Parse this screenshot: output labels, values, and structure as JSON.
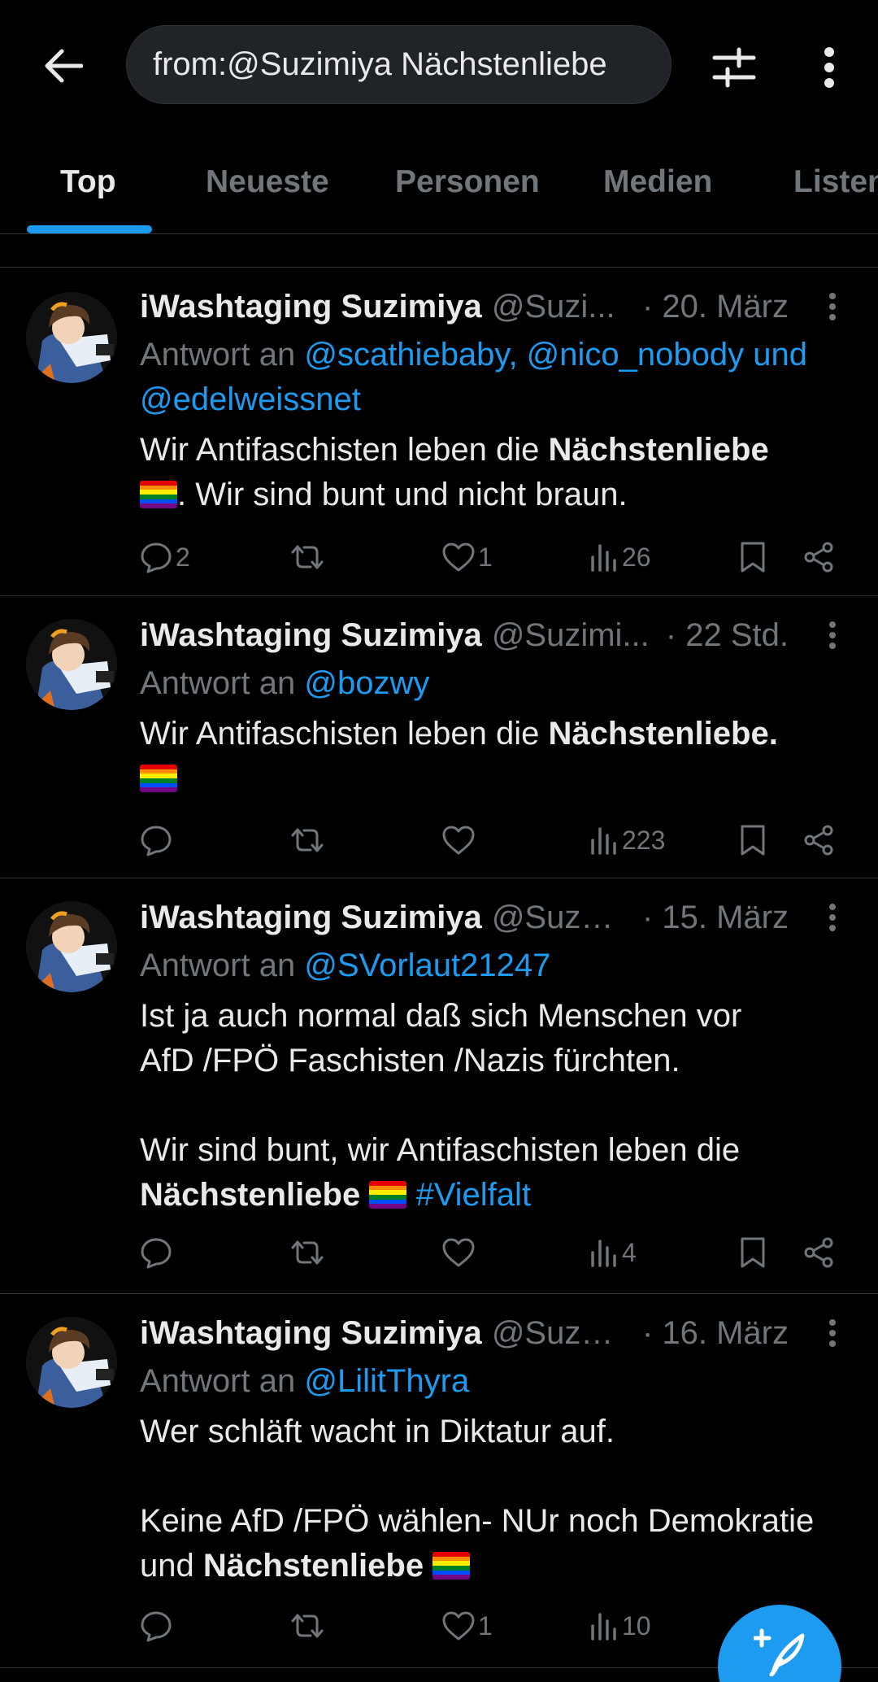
{
  "header": {
    "search_value": "from:@Suzimiya Nächstenliebe"
  },
  "tabs": [
    {
      "label": "Top"
    },
    {
      "label": "Neueste"
    },
    {
      "label": "Personen"
    },
    {
      "label": "Medien"
    },
    {
      "label": "Listen"
    }
  ],
  "tweets": [
    {
      "name": "iWashtaging Suzimiya",
      "handle": "@Suzi...",
      "time": "· 20. März",
      "reply_prefix": "Antwort an",
      "reply_mentions_line1": "@scathiebaby, @nico_nobody und",
      "reply_mentions_line2": "@edelweissnet",
      "text_a": "Wir Antifaschisten leben die ",
      "text_bold": "Nächstenliebe",
      "text_b": ". Wir sind bunt und nicht braun.",
      "replies": "2",
      "retweets": "",
      "likes": "1",
      "views": "26"
    },
    {
      "name": "iWashtaging Suzimiya",
      "handle": "@Suzimi...",
      "time": "· 22 Std.",
      "reply_prefix": "Antwort an",
      "reply_mentions": "@bozwy",
      "text_a": "Wir Antifaschisten leben die ",
      "text_bold": "Nächstenliebe.",
      "replies": "",
      "retweets": "",
      "likes": "",
      "views": "223"
    },
    {
      "name": "iWashtaging Suzimiya",
      "handle": "@Suzi...",
      "time": "· 15. März",
      "reply_prefix": "Antwort an",
      "reply_mentions": "@SVorlaut21247",
      "text_line1": "Ist ja auch normal daß sich Menschen vor",
      "text_line2": "AfD /FPÖ Faschisten /Nazis fürchten.",
      "text_line3": "Wir sind bunt, wir Antifaschisten leben die",
      "text_bold": "Nächstenliebe",
      "hashtag": "#Vielfalt",
      "replies": "",
      "retweets": "",
      "likes": "",
      "views": "4"
    },
    {
      "name": "iWashtaging Suzimiya",
      "handle": "@Suzi...",
      "time": "· 16. März",
      "reply_prefix": "Antwort an",
      "reply_mentions": "@LilitThyra",
      "text_line1": "Wer schläft wacht in Diktatur auf.",
      "text_line2": "Keine AfD /FPÖ wählen- NUr noch Demokratie",
      "text_line3a": "und ",
      "text_bold": "Nächstenliebe",
      "replies": "",
      "retweets": "",
      "likes": "1",
      "views": "10"
    }
  ],
  "colors": {
    "background": "#000000",
    "accent": "#1d9bf0",
    "text": "#e7e9ea",
    "muted": "#71767b",
    "divider": "#2f3336"
  },
  "icons": [
    "back-arrow-icon",
    "filter-sliders-icon",
    "more-vertical-icon",
    "reply-icon",
    "retweet-icon",
    "like-icon",
    "views-icon",
    "bookmark-icon",
    "share-icon",
    "compose-icon",
    "rainbow-flag-icon"
  ]
}
